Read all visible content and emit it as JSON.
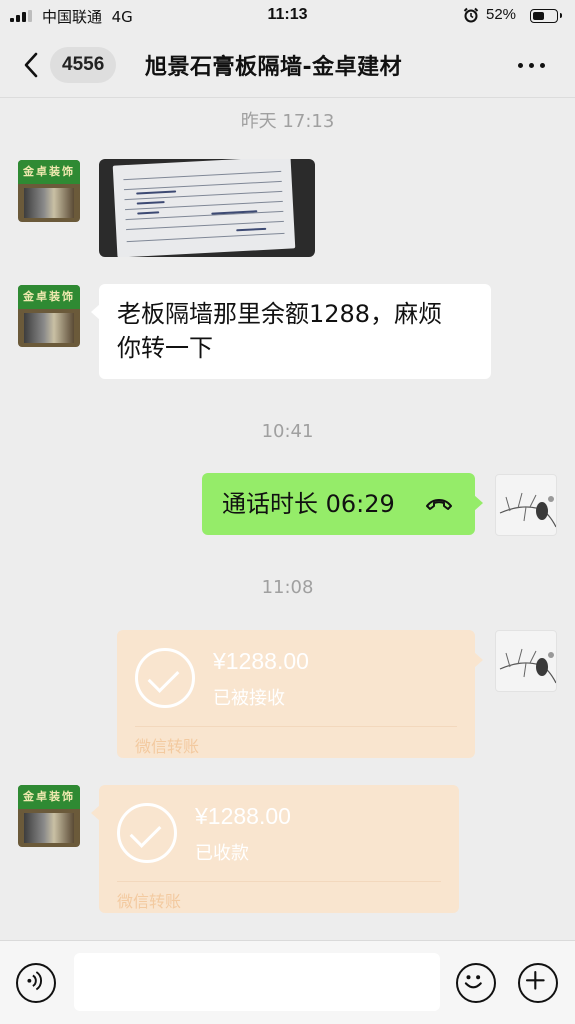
{
  "status_bar": {
    "carrier": "中国联通",
    "network": "4G",
    "time": "11:13",
    "battery_percent": "52%",
    "battery_level": 0.52,
    "icons": [
      "signal-icon",
      "alarm-icon",
      "battery-icon"
    ]
  },
  "nav": {
    "back_icon": "chevron-left-icon",
    "unread_count": "4556",
    "title": "旭景石膏板隔墙-金卓建材",
    "more_icon": "more-dots-icon"
  },
  "messages": [
    {
      "type": "timestamp",
      "text": "昨天 17:13"
    },
    {
      "type": "image",
      "side": "left",
      "avatar": "store-avatar",
      "content": "receipt-photo"
    },
    {
      "type": "text",
      "side": "left",
      "avatar": "store-avatar",
      "lines": [
        "老板隔墙那里余额1288，麻烦",
        "你转一下"
      ]
    },
    {
      "type": "timestamp",
      "text": "10:41"
    },
    {
      "type": "call",
      "side": "right",
      "avatar": "branch-avatar",
      "text": "通话时长 06:29",
      "icon": "phone-hangup-icon"
    },
    {
      "type": "timestamp",
      "text": "11:08"
    },
    {
      "type": "transfer",
      "side": "right",
      "avatar": "branch-avatar",
      "amount": "¥1288.00",
      "status": "已被接收",
      "footer": "微信转账"
    },
    {
      "type": "transfer",
      "side": "left",
      "avatar": "store-avatar",
      "amount": "¥1288.00",
      "status": "已收款",
      "footer": "微信转账"
    }
  ],
  "store_avatar_sign": "金卓装饰",
  "input_bar": {
    "voice_icon": "voice-icon",
    "input_value": "",
    "emoji_icon": "emoji-icon",
    "plus_icon": "plus-icon"
  },
  "colors": {
    "background": "#ededed",
    "bubble_green": "#95ec69",
    "bubble_white": "#ffffff",
    "transfer_done": "#f9e5cf",
    "timestamp_text": "#a0a0a0"
  }
}
